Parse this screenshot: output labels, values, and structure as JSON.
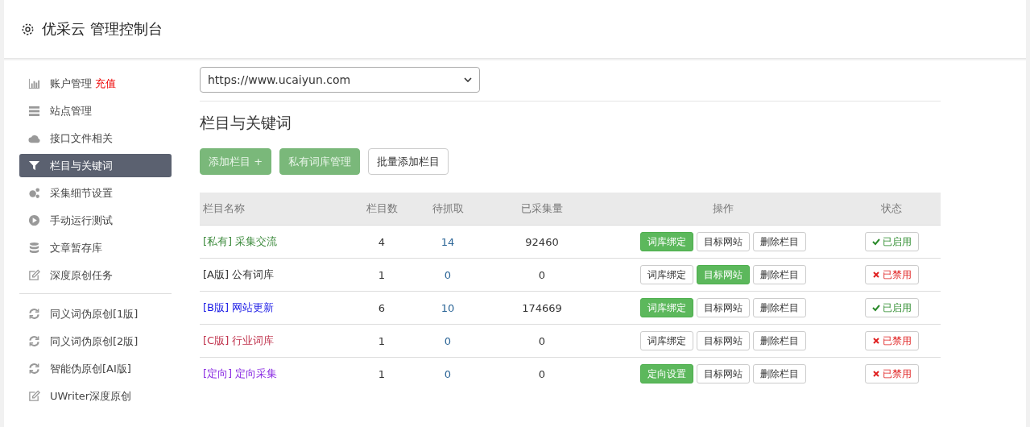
{
  "header": {
    "title": "优采云 管理控制台"
  },
  "sidebar": {
    "groups": [
      {
        "items": [
          {
            "label": "账户管理",
            "badge": "充值",
            "kind": "chart",
            "selected": false
          },
          {
            "label": "站点管理",
            "kind": "server",
            "selected": false
          },
          {
            "label": "接口文件相关",
            "kind": "cloud",
            "selected": false
          },
          {
            "label": "栏目与关键词",
            "kind": "filter",
            "selected": true
          },
          {
            "label": "采集细节设置",
            "kind": "gears",
            "selected": false
          },
          {
            "label": "手动运行测试",
            "kind": "play",
            "selected": false
          },
          {
            "label": "文章暂存库",
            "kind": "database",
            "selected": false
          },
          {
            "label": "深度原创任务",
            "kind": "edit",
            "selected": false
          }
        ]
      },
      {
        "items": [
          {
            "label": "同义词伪原创[1版]",
            "kind": "refresh",
            "selected": false
          },
          {
            "label": "同义词伪原创[2版]",
            "kind": "refresh",
            "selected": false
          },
          {
            "label": "智能伪原创[AI版]",
            "kind": "refresh",
            "selected": false
          },
          {
            "label": "UWriter深度原创",
            "kind": "edit",
            "selected": false
          }
        ]
      }
    ]
  },
  "site_select": {
    "value": "https://www.ucaiyun.com"
  },
  "section_title": "栏目与关键词",
  "toolbar": [
    {
      "label": "添加栏目 +",
      "primary": true
    },
    {
      "label": "私有词库管理",
      "primary": true
    },
    {
      "label": "批量添加栏目",
      "primary": false
    }
  ],
  "table": {
    "columns": [
      "栏目名称",
      "栏目数",
      "待抓取",
      "已采集量",
      "操作",
      "状态"
    ],
    "rows": [
      {
        "tag": "[私有]",
        "name": "采集交流",
        "color": "#3c8a3c",
        "col2": "4",
        "col3": "14",
        "col4": "92460",
        "actions": [
          {
            "label": "词库绑定",
            "primary": true
          },
          {
            "label": "目标网站",
            "primary": false
          },
          {
            "label": "删除栏目",
            "primary": false
          }
        ],
        "status": "已启用",
        "enabled": true
      },
      {
        "tag": "[A版]",
        "name": "公有词库",
        "color": "#333333",
        "col2": "1",
        "col3": "0",
        "col4": "0",
        "actions": [
          {
            "label": "词库绑定",
            "primary": false
          },
          {
            "label": "目标网站",
            "primary": true
          },
          {
            "label": "删除栏目",
            "primary": false
          }
        ],
        "status": "已禁用",
        "enabled": false
      },
      {
        "tag": "[B版]",
        "name": "网站更新",
        "color": "#1a1ae6",
        "col2": "6",
        "col3": "10",
        "col4": "174669",
        "actions": [
          {
            "label": "词库绑定",
            "primary": true
          },
          {
            "label": "目标网站",
            "primary": false
          },
          {
            "label": "删除栏目",
            "primary": false
          }
        ],
        "status": "已启用",
        "enabled": true
      },
      {
        "tag": "[C版]",
        "name": "行业词库",
        "color": "#c0334d",
        "col2": "1",
        "col3": "0",
        "col4": "0",
        "actions": [
          {
            "label": "词库绑定",
            "primary": false
          },
          {
            "label": "目标网站",
            "primary": false
          },
          {
            "label": "删除栏目",
            "primary": false
          }
        ],
        "status": "已禁用",
        "enabled": false
      },
      {
        "tag": "[定向]",
        "name": "定向采集",
        "color": "#8a2be2",
        "col2": "1",
        "col3": "0",
        "col4": "0",
        "actions": [
          {
            "label": "定向设置",
            "primary": true
          },
          {
            "label": "目标网站",
            "primary": false
          },
          {
            "label": "删除栏目",
            "primary": false
          }
        ],
        "status": "已禁用",
        "enabled": false
      }
    ]
  }
}
